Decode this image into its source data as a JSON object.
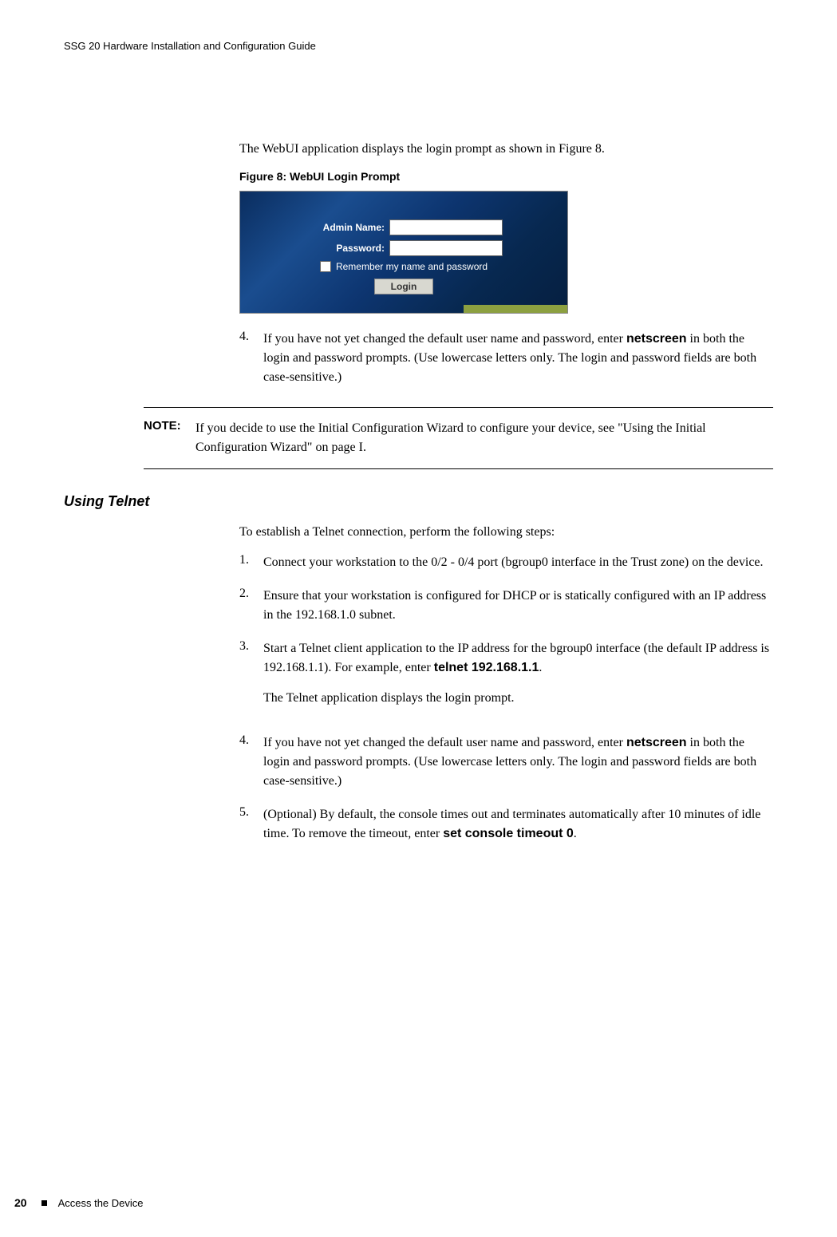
{
  "header": "SSG 20 Hardware Installation and Configuration Guide",
  "intro": "The WebUI application displays the login prompt as shown in Figure 8.",
  "figure_caption": "Figure 8:  WebUI Login Prompt",
  "login_prompt": {
    "admin_label": "Admin Name:",
    "password_label": "Password:",
    "remember_text": "Remember my name and password",
    "login_button": "Login"
  },
  "step4_num": "4.",
  "step4_pre": "If you have not yet changed the default user name and password, enter ",
  "step4_bold": "netscreen",
  "step4_post": " in both the login and password prompts. (Use lowercase letters only. The login and password fields are both case-sensitive.)",
  "note_label": "NOTE:",
  "note_body": "If you decide to use the Initial Configuration Wizard to configure your device, see \"Using the Initial Configuration Wizard\" on page I.",
  "section_heading": "Using Telnet",
  "telnet_intro": "To establish a Telnet connection, perform the following steps:",
  "t_step1_num": "1.",
  "t_step1": "Connect your workstation to the 0/2 - 0/4 port (bgroup0 interface in the Trust zone) on the device.",
  "t_step2_num": "2.",
  "t_step2": "Ensure that your workstation is configured for DHCP or is statically configured with an IP address in the 192.168.1.0 subnet.",
  "t_step3_num": "3.",
  "t_step3_pre": "Start a Telnet client application to the IP address for the bgroup0 interface (the default IP address is 192.168.1.1). For example, enter ",
  "t_step3_bold": "telnet 192.168.1.1",
  "t_step3_post": ".",
  "t_step3_sub": "The Telnet application displays the login prompt.",
  "t_step4_num": "4.",
  "t_step4_pre": "If you have not yet changed the default user name and password, enter ",
  "t_step4_bold": "netscreen",
  "t_step4_post": " in both the login and password prompts. (Use lowercase letters only. The login and password fields are both case-sensitive.)",
  "t_step5_num": "5.",
  "t_step5_pre": "(Optional) By default, the console times out and terminates automatically after 10 minutes of idle time. To remove the timeout, enter ",
  "t_step5_bold": "set console timeout 0",
  "t_step5_post": ".",
  "footer_page": "20",
  "footer_section": "Access the Device"
}
